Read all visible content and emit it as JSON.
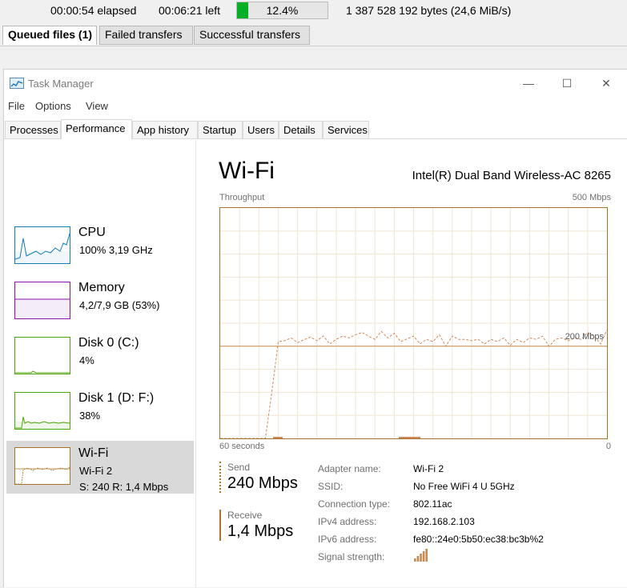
{
  "transfer_status": {
    "elapsed": "00:00:54 elapsed",
    "left": "00:06:21 left",
    "progress_percent": 12.4,
    "progress_text": "12.4%",
    "bytes": "1 387 528 192 bytes (24,6 MiB/s)"
  },
  "queue_tabs": [
    {
      "label": "Queued files (1)",
      "active": true
    },
    {
      "label": "Failed transfers",
      "active": false
    },
    {
      "label": "Successful transfers",
      "active": false
    }
  ],
  "window": {
    "title": "Task Manager",
    "minimize": "—",
    "maximize": "☐",
    "close": "✕"
  },
  "menu": [
    "File",
    "Options",
    "View"
  ],
  "tabs": [
    "Processes",
    "Performance",
    "App history",
    "Startup",
    "Users",
    "Details",
    "Services"
  ],
  "active_tab": "Performance",
  "sidebar": [
    {
      "title": "CPU",
      "sub1": "100% 3,19 GHz",
      "sub2": "",
      "color": "#117dbb"
    },
    {
      "title": "Memory",
      "sub1": "4,2/7,9 GB (53%)",
      "sub2": "",
      "color": "#8b12ae"
    },
    {
      "title": "Disk 0 (C:)",
      "sub1": "4%",
      "sub2": "",
      "color": "#4da60c"
    },
    {
      "title": "Disk 1 (D: F:)",
      "sub1": "38%",
      "sub2": "",
      "color": "#4da60c"
    },
    {
      "title": "Wi-Fi",
      "sub1": "Wi-Fi 2",
      "sub2": "S: 240 R: 1,4 Mbps",
      "color": "#a8742a"
    }
  ],
  "main": {
    "heading": "Wi-Fi",
    "device": "Intel(R) Dual Band Wireless-AC 8265",
    "throughput_label": "Throughput",
    "max_label": "500 Mbps",
    "mid_label": "200 Mbps",
    "time_label": "60 seconds",
    "zero_label": "0",
    "send_label": "Send",
    "send_value": "240 Mbps",
    "receive_label": "Receive",
    "receive_value": "1,4 Mbps",
    "info": [
      {
        "key": "Adapter name:",
        "value": "Wi-Fi 2"
      },
      {
        "key": "SSID:",
        "value": "No Free WiFi 4 U 5GHz"
      },
      {
        "key": "Connection type:",
        "value": "802.11ac"
      },
      {
        "key": "IPv4 address:",
        "value": "192.168.2.103"
      },
      {
        "key": "IPv6 address:",
        "value": "fe80::24e0:5b50:ec38:bc3b%2"
      }
    ],
    "signal_label": "Signal strength:",
    "signal_bars": 5
  },
  "chart_data": {
    "type": "line",
    "xlabel": "60 seconds",
    "ylabel": "Throughput",
    "xlim": [
      60,
      0
    ],
    "ylim": [
      0,
      500
    ],
    "reference_line": 200,
    "series": [
      {
        "values": [
          0,
          0,
          0,
          0,
          0,
          0,
          0,
          0,
          100,
          210,
          212,
          218,
          208,
          214,
          220,
          212,
          222,
          205,
          215,
          222,
          218,
          225,
          230,
          222,
          215,
          232,
          218,
          228,
          210,
          216,
          222,
          205,
          215,
          210,
          225,
          200,
          222,
          215,
          215,
          212,
          215,
          205,
          215,
          210,
          218,
          202,
          215,
          208,
          218,
          215,
          222,
          200,
          215,
          218,
          212,
          218,
          215,
          230,
          222,
          205,
          235
        ]
      }
    ]
  }
}
